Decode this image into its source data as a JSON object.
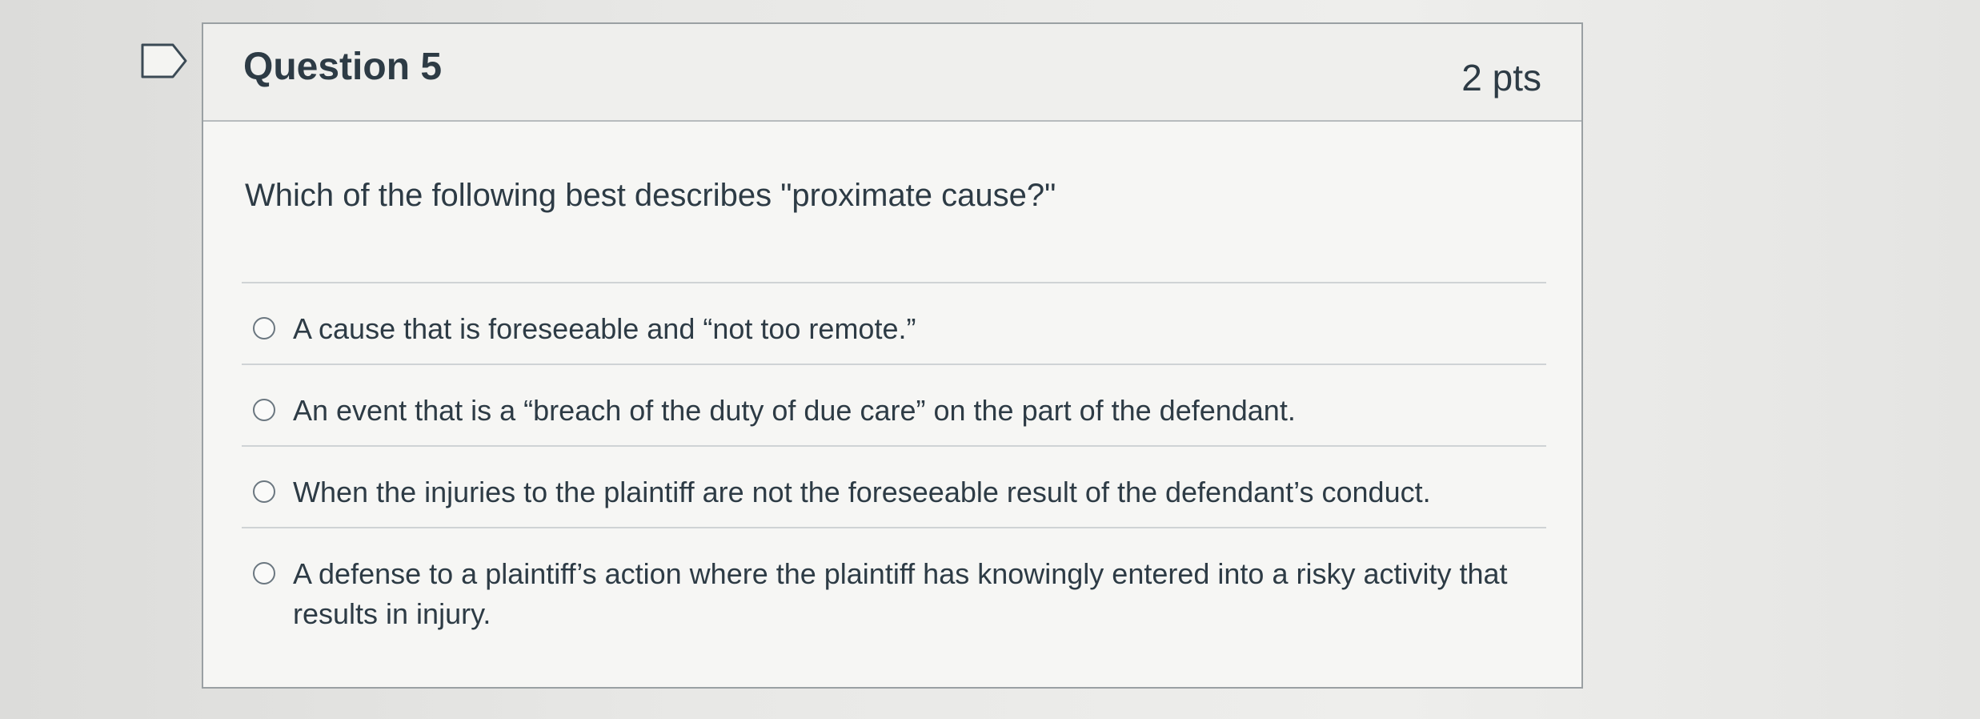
{
  "question": {
    "title": "Question 5",
    "points": "2 pts",
    "text": "Which of the following best describes \"proximate cause?\"",
    "flag_icon": "bookmark-flag-icon"
  },
  "answers": [
    {
      "label": "A cause that is foreseeable and “not too remote.”",
      "selected": false
    },
    {
      "label": "An event that is a “breach of the duty of due care” on the part of the defendant.",
      "selected": false
    },
    {
      "label": "When the injuries to the plaintiff are not the foreseeable result of the defendant’s conduct.",
      "selected": false
    },
    {
      "label": "A defense to a plaintiff’s action where the plaintiff has knowingly entered into a risky activity that results in injury.",
      "selected": false
    }
  ],
  "colors": {
    "text": "#2d3b45",
    "border": "#9aa0a3",
    "radio_border": "#6b7780"
  }
}
